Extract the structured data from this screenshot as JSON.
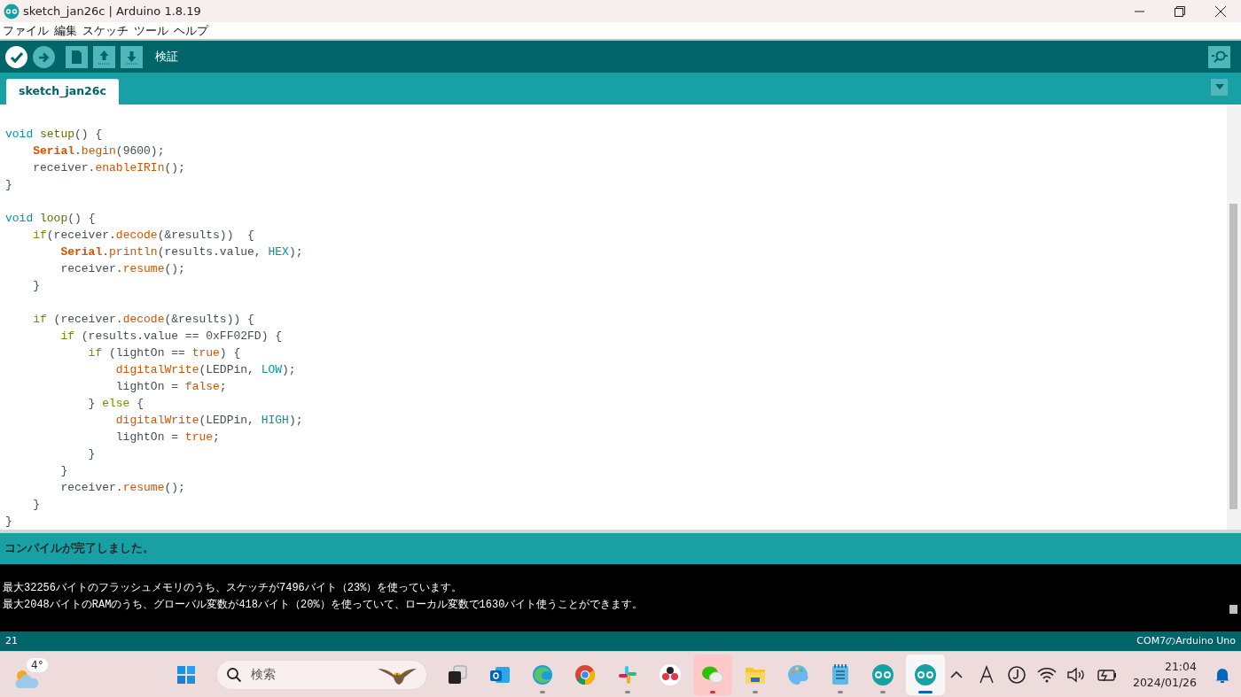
{
  "window": {
    "title": "sketch_jan26c | Arduino 1.8.19"
  },
  "menu": [
    "ファイル",
    "編集",
    "スケッチ",
    "ツール",
    "ヘルプ"
  ],
  "toolbar": {
    "buttons": [
      {
        "kind": "verify",
        "selected": true
      },
      {
        "kind": "upload",
        "selected": false
      },
      {
        "kind": "new",
        "selected": false
      },
      {
        "kind": "open",
        "selected": false
      },
      {
        "kind": "save",
        "selected": false
      }
    ],
    "hint": "検証"
  },
  "tabs": [
    {
      "label": "sketch_jan26c",
      "selected": true
    }
  ],
  "editor": {
    "lines": [
      {
        "kind": "code",
        "tokens": [
          {
            "text": "void ",
            "kind": "type"
          },
          {
            "text": "setup",
            "kind": "struct"
          },
          {
            "text": "() {",
            "kind": "plain"
          }
        ]
      },
      {
        "kind": "code",
        "tokens": [
          {
            "text": "    Serial",
            "kind": "class"
          },
          {
            "text": ".",
            "kind": "plain"
          },
          {
            "text": "begin",
            "kind": "func"
          },
          {
            "text": "(9600);",
            "kind": "plain"
          }
        ]
      },
      {
        "kind": "code",
        "tokens": [
          {
            "text": "    receiver.",
            "kind": "plain"
          },
          {
            "text": "enableIRIn",
            "kind": "func"
          },
          {
            "text": "();",
            "kind": "plain"
          }
        ]
      },
      {
        "kind": "code",
        "tokens": [
          {
            "text": "}",
            "kind": "plain"
          }
        ]
      },
      {
        "kind": "blank"
      },
      {
        "kind": "code",
        "tokens": [
          {
            "text": "void ",
            "kind": "type"
          },
          {
            "text": "loop",
            "kind": "struct"
          },
          {
            "text": "() {",
            "kind": "plain"
          }
        ]
      },
      {
        "kind": "code",
        "tokens": [
          {
            "text": "    if",
            "kind": "keyword"
          },
          {
            "text": "(receiver.",
            "kind": "plain"
          },
          {
            "text": "decode",
            "kind": "func"
          },
          {
            "text": "(&results))  {",
            "kind": "plain"
          }
        ]
      },
      {
        "kind": "code",
        "tokens": [
          {
            "text": "        Serial",
            "kind": "class"
          },
          {
            "text": ".",
            "kind": "plain"
          },
          {
            "text": "println",
            "kind": "func"
          },
          {
            "text": "(results.value, ",
            "kind": "plain"
          },
          {
            "text": "HEX",
            "kind": "const"
          },
          {
            "text": ");",
            "kind": "plain"
          }
        ]
      },
      {
        "kind": "code",
        "tokens": [
          {
            "text": "        receiver.",
            "kind": "plain"
          },
          {
            "text": "resume",
            "kind": "func"
          },
          {
            "text": "();",
            "kind": "plain"
          }
        ]
      },
      {
        "kind": "code",
        "tokens": [
          {
            "text": "    }",
            "kind": "plain"
          }
        ]
      },
      {
        "kind": "blank"
      },
      {
        "kind": "code",
        "tokens": [
          {
            "text": "    if",
            "kind": "keyword"
          },
          {
            "text": " (receiver.",
            "kind": "plain"
          },
          {
            "text": "decode",
            "kind": "func"
          },
          {
            "text": "(&results)) {",
            "kind": "plain"
          }
        ]
      },
      {
        "kind": "code",
        "tokens": [
          {
            "text": "        if",
            "kind": "keyword"
          },
          {
            "text": " (results.value == 0xFF02FD) {",
            "kind": "plain"
          }
        ]
      },
      {
        "kind": "code",
        "tokens": [
          {
            "text": "            if",
            "kind": "keyword"
          },
          {
            "text": " (lightOn == ",
            "kind": "plain"
          },
          {
            "text": "true",
            "kind": "func"
          },
          {
            "text": ") {",
            "kind": "plain"
          }
        ]
      },
      {
        "kind": "code",
        "tokens": [
          {
            "text": "                digitalWrite",
            "kind": "func"
          },
          {
            "text": "(LEDPin, ",
            "kind": "plain"
          },
          {
            "text": "LOW",
            "kind": "const"
          },
          {
            "text": ");",
            "kind": "plain"
          }
        ]
      },
      {
        "kind": "code",
        "tokens": [
          {
            "text": "                lightOn = ",
            "kind": "plain"
          },
          {
            "text": "false",
            "kind": "func"
          },
          {
            "text": ";",
            "kind": "plain"
          }
        ]
      },
      {
        "kind": "code",
        "tokens": [
          {
            "text": "            } ",
            "kind": "plain"
          },
          {
            "text": "else",
            "kind": "keyword"
          },
          {
            "text": " {",
            "kind": "plain"
          }
        ]
      },
      {
        "kind": "code",
        "tokens": [
          {
            "text": "                digitalWrite",
            "kind": "func"
          },
          {
            "text": "(LEDPin, ",
            "kind": "plain"
          },
          {
            "text": "HIGH",
            "kind": "const"
          },
          {
            "text": ");",
            "kind": "plain"
          }
        ]
      },
      {
        "kind": "code",
        "tokens": [
          {
            "text": "                lightOn = ",
            "kind": "plain"
          },
          {
            "text": "true",
            "kind": "func"
          },
          {
            "text": ";",
            "kind": "plain"
          }
        ]
      },
      {
        "kind": "code",
        "tokens": [
          {
            "text": "            }",
            "kind": "plain"
          }
        ]
      },
      {
        "kind": "code",
        "tokens": [
          {
            "text": "        }",
            "kind": "plain"
          }
        ]
      },
      {
        "kind": "code",
        "tokens": [
          {
            "text": "        receiver.",
            "kind": "plain"
          },
          {
            "text": "resume",
            "kind": "func"
          },
          {
            "text": "();",
            "kind": "plain"
          }
        ]
      },
      {
        "kind": "code",
        "tokens": [
          {
            "text": "    }",
            "kind": "plain"
          }
        ]
      },
      {
        "kind": "code",
        "tokens": [
          {
            "text": "}",
            "kind": "plain"
          }
        ]
      }
    ]
  },
  "console": {
    "message": "コンパイルが完了しました。",
    "lines": [
      "最大32256バイトのフラッシュメモリのうち、スケッチが7496バイト（23%）を使っています。",
      "最大2048バイトのRAMのうち、グローバル変数が418バイト（20%）を使っていて、ローカル変数で1630バイト使うことができます。"
    ]
  },
  "status_bar": {
    "line": "21",
    "board": "COM7のArduino Uno"
  },
  "taskbar": {
    "weather": "4°",
    "search": {
      "placeholder": "検索"
    },
    "apps": [
      {
        "kind": "start",
        "running": false,
        "alert": false,
        "active": false
      },
      {
        "kind": "taskview",
        "running": false,
        "alert": false,
        "active": false
      },
      {
        "kind": "mail",
        "running": false,
        "alert": false,
        "active": false
      },
      {
        "kind": "edge",
        "running": true,
        "alert": false,
        "active": false
      },
      {
        "kind": "chrome",
        "running": false,
        "alert": false,
        "active": false
      },
      {
        "kind": "slack",
        "running": true,
        "alert": false,
        "active": false
      },
      {
        "kind": "dots",
        "running": false,
        "alert": false,
        "active": false
      },
      {
        "kind": "chat",
        "running": true,
        "alert": true,
        "active": false
      },
      {
        "kind": "folder",
        "running": true,
        "alert": false,
        "active": false
      },
      {
        "kind": "paint",
        "running": false,
        "alert": false,
        "active": false
      },
      {
        "kind": "notepad",
        "running": true,
        "alert": false,
        "active": false
      },
      {
        "kind": "arduino",
        "running": true,
        "alert": false,
        "active": false
      },
      {
        "kind": "arduino",
        "running": true,
        "alert": false,
        "active": true
      }
    ],
    "clock": {
      "time": "21:04",
      "date": "2024/01/26"
    }
  }
}
